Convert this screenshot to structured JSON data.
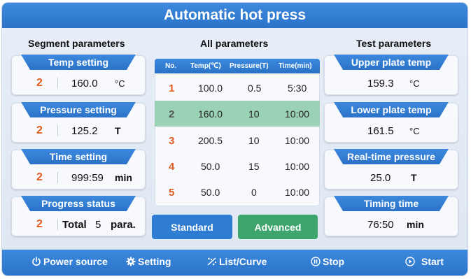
{
  "title": "Automatic hot press",
  "columns": {
    "segment": "Segment parameters",
    "all": "All parameters",
    "test": "Test parameters"
  },
  "segment_cards": [
    {
      "label": "Temp setting",
      "segment": "2",
      "value": "160.0",
      "unit": "°C"
    },
    {
      "label": "Pressure setting",
      "segment": "2",
      "value": "125.2",
      "unit": "T"
    },
    {
      "label": "Time setting",
      "segment": "2",
      "value": "999:59",
      "unit": "min"
    },
    {
      "label": "Progress status",
      "segment": "2",
      "total_label": "Total",
      "value": "5",
      "unit": "para."
    }
  ],
  "table": {
    "headers": [
      "No.",
      "Temp(℃)",
      "Pressure(T)",
      "Time(min)"
    ],
    "rows": [
      {
        "no": "1",
        "temp": "100.0",
        "pressure": "0.5",
        "time": "5:30"
      },
      {
        "no": "2",
        "temp": "160.0",
        "pressure": "10",
        "time": "10:00"
      },
      {
        "no": "3",
        "temp": "200.5",
        "pressure": "10",
        "time": "10:00"
      },
      {
        "no": "4",
        "temp": "50.0",
        "pressure": "15",
        "time": "10:00"
      },
      {
        "no": "5",
        "temp": "50.0",
        "pressure": "0",
        "time": "10:00"
      }
    ],
    "selected_row": 2
  },
  "buttons": {
    "standard": "Standard",
    "advanced": "Advanced"
  },
  "test_cards": [
    {
      "label": "Upper plate temp",
      "value": "159.3",
      "unit": "°C"
    },
    {
      "label": "Lower plate temp",
      "value": "161.5",
      "unit": "°C"
    },
    {
      "label": "Real-time pressure",
      "value": "25.0",
      "unit": "T"
    },
    {
      "label": "Timing time",
      "value": "76:50",
      "unit": "min"
    }
  ],
  "bottom_nav": [
    {
      "label": "Power source",
      "icon": "power-icon"
    },
    {
      "label": "Setting",
      "icon": "gear-icon"
    },
    {
      "label": "List/Curve",
      "icon": "list-curve-icon"
    },
    {
      "label": "Stop",
      "icon": "pause-icon"
    },
    {
      "label": "Start",
      "icon": "play-icon"
    }
  ],
  "colors": {
    "primary_blue": "#2f7dd3",
    "advanced_green": "#3da56c",
    "selected_row": "#9bd2b6",
    "segment_number": "#e05a1e"
  }
}
